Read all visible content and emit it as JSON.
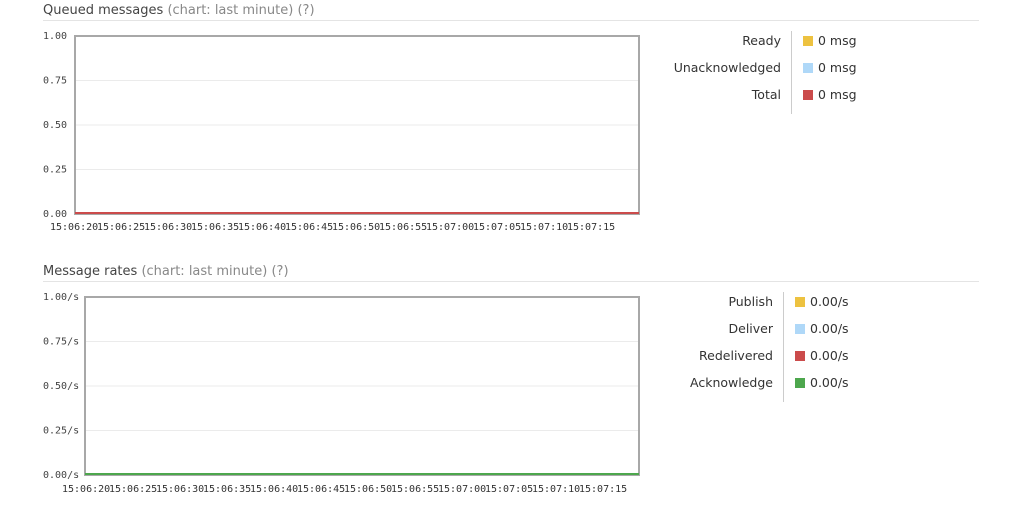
{
  "chart_data": [
    {
      "type": "line",
      "title": "Queued messages",
      "subtitle": "(chart: last minute)",
      "help": "(?)",
      "xlabel": "",
      "ylabel": "",
      "ylim": [
        0,
        1
      ],
      "y_ticks": [
        "1.00",
        "0.75",
        "0.50",
        "0.25",
        "0.00"
      ],
      "y_tick_values": [
        1,
        0.75,
        0.5,
        0.25,
        0
      ],
      "x_ticks": [
        "15:06:20",
        "15:06:25",
        "15:06:30",
        "15:06:35",
        "15:06:40",
        "15:06:45",
        "15:06:50",
        "15:06:55",
        "15:07:00",
        "15:07:05",
        "15:07:10",
        "15:07:15"
      ],
      "grid": true,
      "legend_position": "right",
      "series": [
        {
          "name": "Ready",
          "color": "#edc240",
          "value_label": "0 msg",
          "values": [
            0,
            0,
            0,
            0,
            0,
            0,
            0,
            0,
            0,
            0,
            0,
            0
          ]
        },
        {
          "name": "Unacknowledged",
          "color": "#afd8f8",
          "value_label": "0 msg",
          "values": [
            0,
            0,
            0,
            0,
            0,
            0,
            0,
            0,
            0,
            0,
            0,
            0
          ]
        },
        {
          "name": "Total",
          "color": "#cb4b4b",
          "value_label": "0 msg",
          "values": [
            0,
            0,
            0,
            0,
            0,
            0,
            0,
            0,
            0,
            0,
            0,
            0
          ]
        }
      ]
    },
    {
      "type": "line",
      "title": "Message rates",
      "subtitle": "(chart: last minute)",
      "help": "(?)",
      "xlabel": "",
      "ylabel": "",
      "ylim": [
        0,
        1
      ],
      "y_ticks": [
        "1.00/s",
        "0.75/s",
        "0.50/s",
        "0.25/s",
        "0.00/s"
      ],
      "y_tick_values": [
        1,
        0.75,
        0.5,
        0.25,
        0
      ],
      "x_ticks": [
        "15:06:20",
        "15:06:25",
        "15:06:30",
        "15:06:35",
        "15:06:40",
        "15:06:45",
        "15:06:50",
        "15:06:55",
        "15:07:00",
        "15:07:05",
        "15:07:10",
        "15:07:15"
      ],
      "grid": true,
      "legend_position": "right",
      "series": [
        {
          "name": "Publish",
          "color": "#edc240",
          "value_label": "0.00/s",
          "values": [
            0,
            0,
            0,
            0,
            0,
            0,
            0,
            0,
            0,
            0,
            0,
            0
          ]
        },
        {
          "name": "Deliver",
          "color": "#afd8f8",
          "value_label": "0.00/s",
          "values": [
            0,
            0,
            0,
            0,
            0,
            0,
            0,
            0,
            0,
            0,
            0,
            0
          ]
        },
        {
          "name": "Redelivered",
          "color": "#cb4b4b",
          "value_label": "0.00/s",
          "values": [
            0,
            0,
            0,
            0,
            0,
            0,
            0,
            0,
            0,
            0,
            0,
            0
          ]
        },
        {
          "name": "Acknowledge",
          "color": "#4da74d",
          "value_label": "0.00/s",
          "values": [
            0,
            0,
            0,
            0,
            0,
            0,
            0,
            0,
            0,
            0,
            0,
            0
          ]
        }
      ]
    }
  ]
}
